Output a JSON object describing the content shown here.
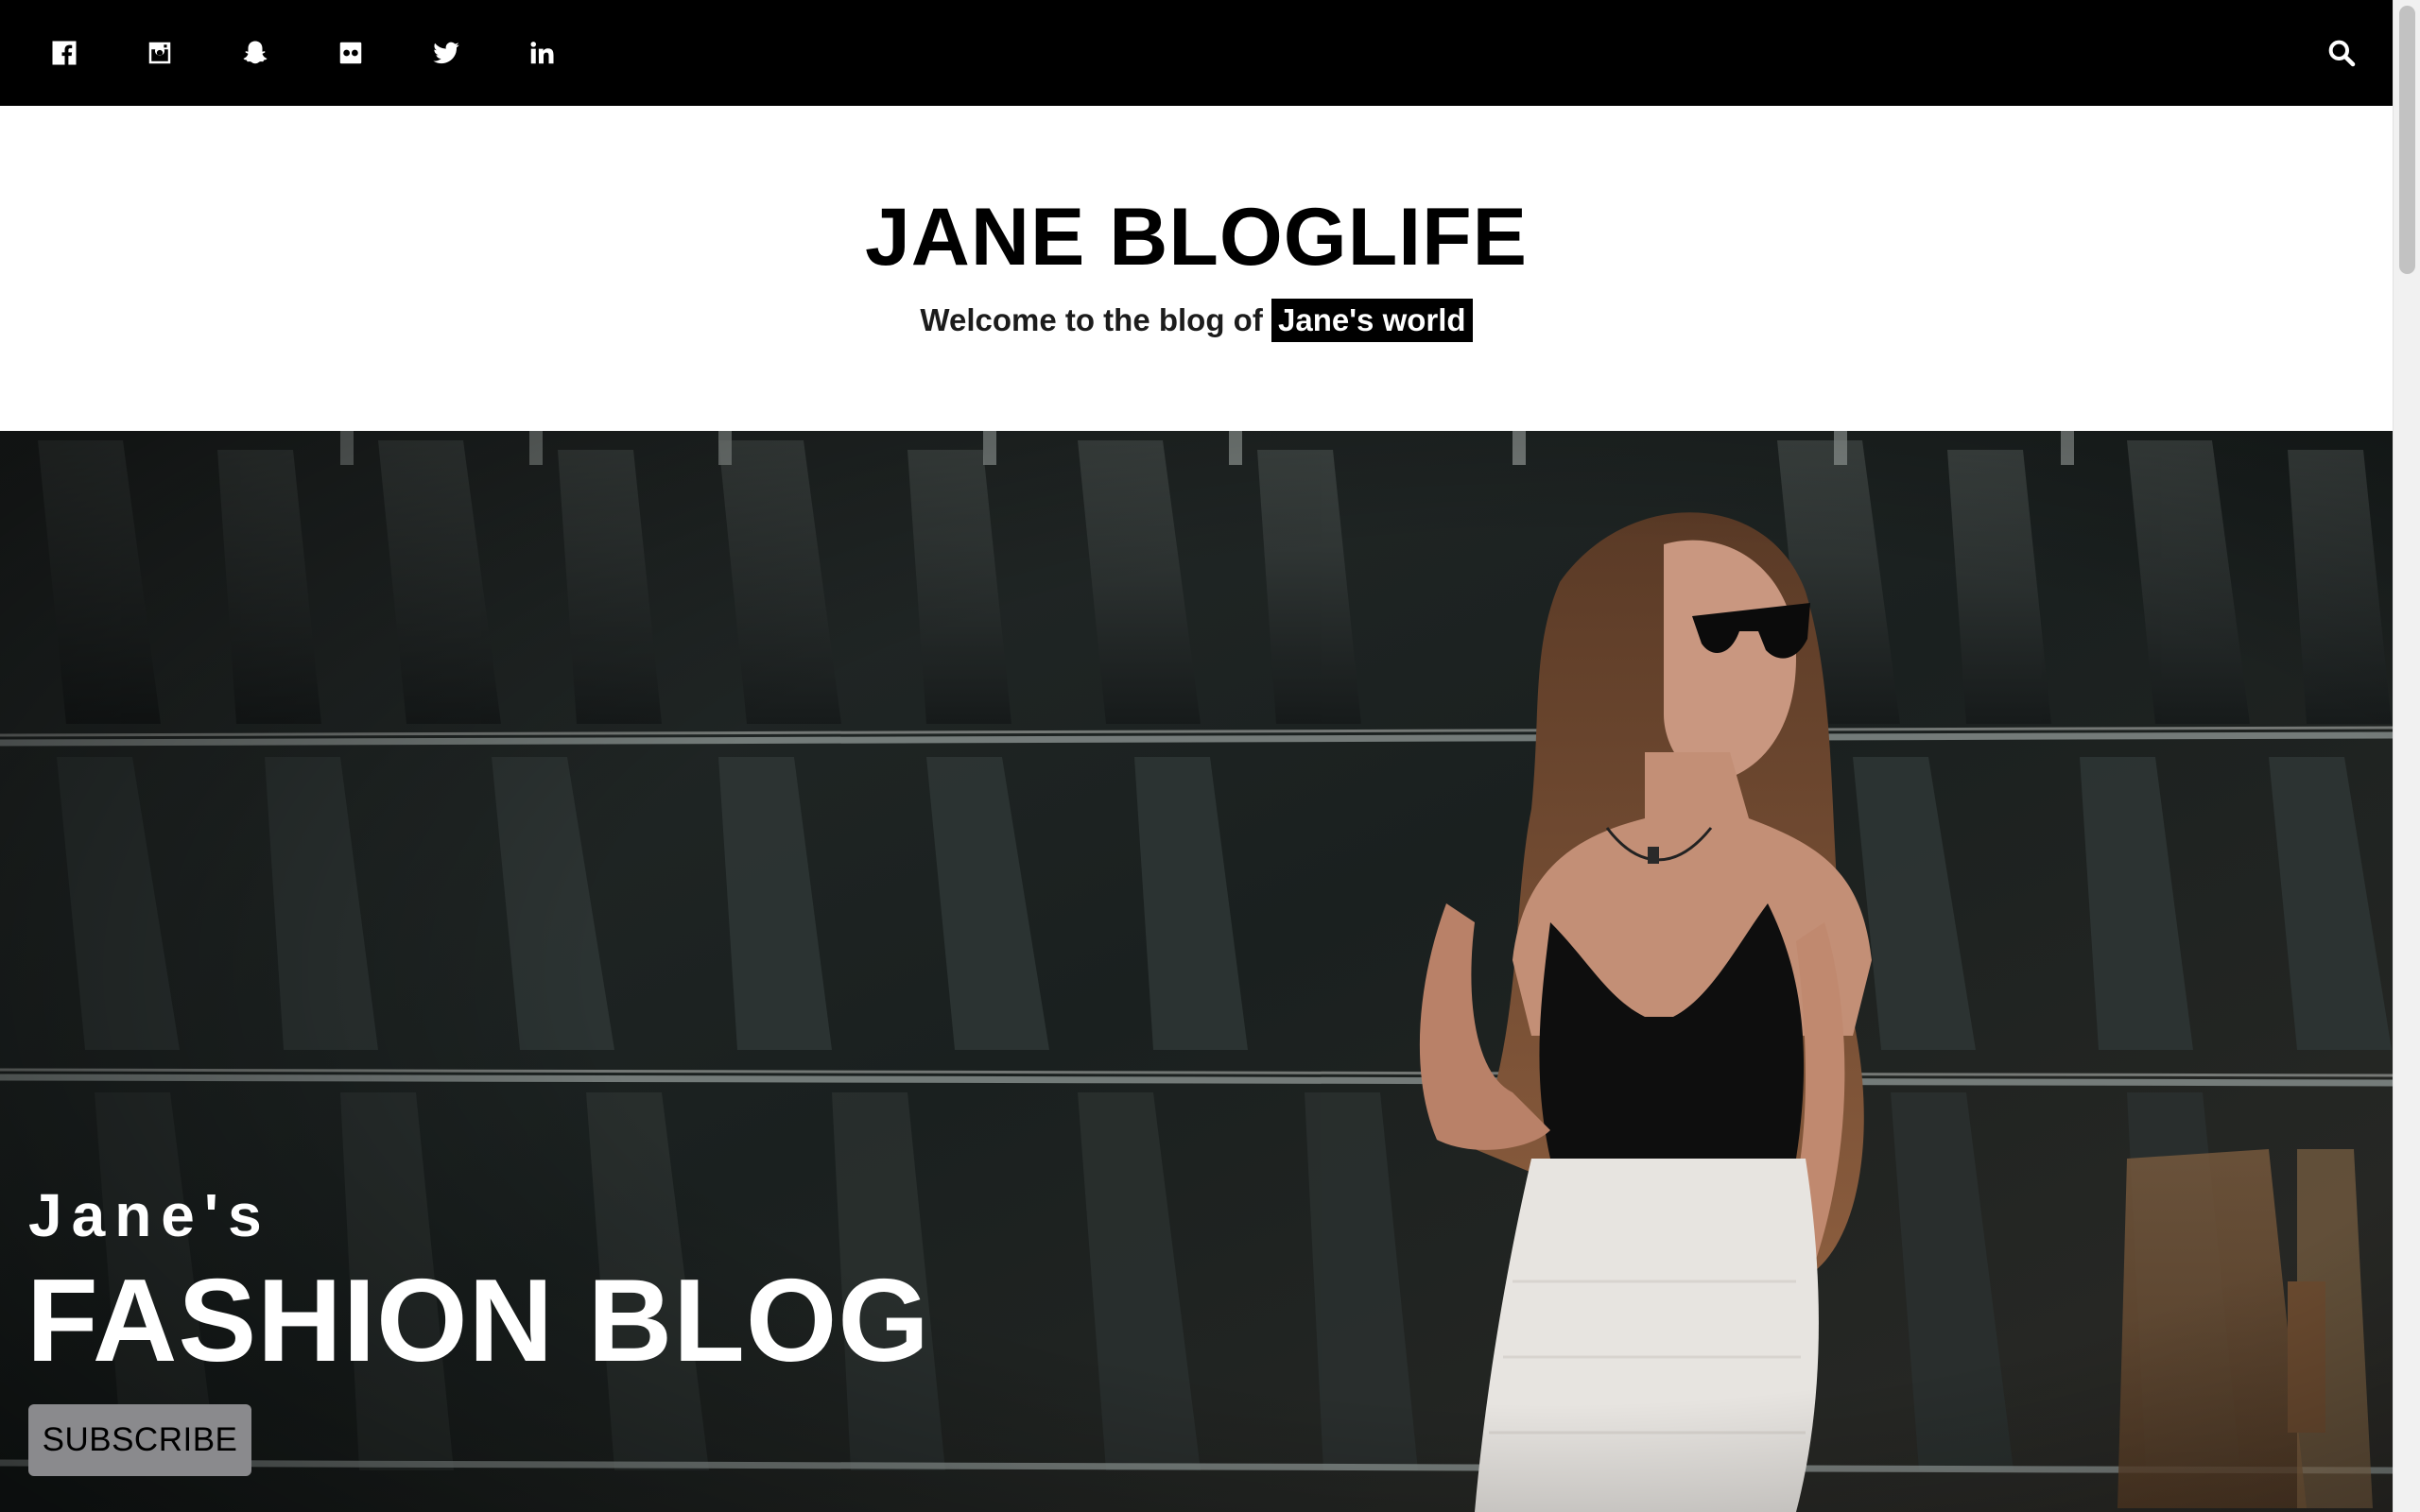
{
  "topbar": {
    "social": [
      {
        "icon": "facebook-icon"
      },
      {
        "icon": "instagram-icon"
      },
      {
        "icon": "snapchat-icon"
      },
      {
        "icon": "flickr-icon"
      },
      {
        "icon": "twitter-icon"
      },
      {
        "icon": "linkedin-icon"
      }
    ],
    "search_icon": "search-icon"
  },
  "header": {
    "title": "JANE BLOGLIFE",
    "tagline_prefix": "Welcome to the blog of",
    "tagline_highlight": "Jane's world"
  },
  "hero": {
    "small_heading": "Jane's",
    "big_heading": "FASHION BLOG",
    "subscribe_label": "SUBSCRIBE"
  },
  "colors": {
    "topbar_bg": "#000000",
    "highlight_bg": "#000000",
    "button_bg": "#8a8a8d"
  }
}
